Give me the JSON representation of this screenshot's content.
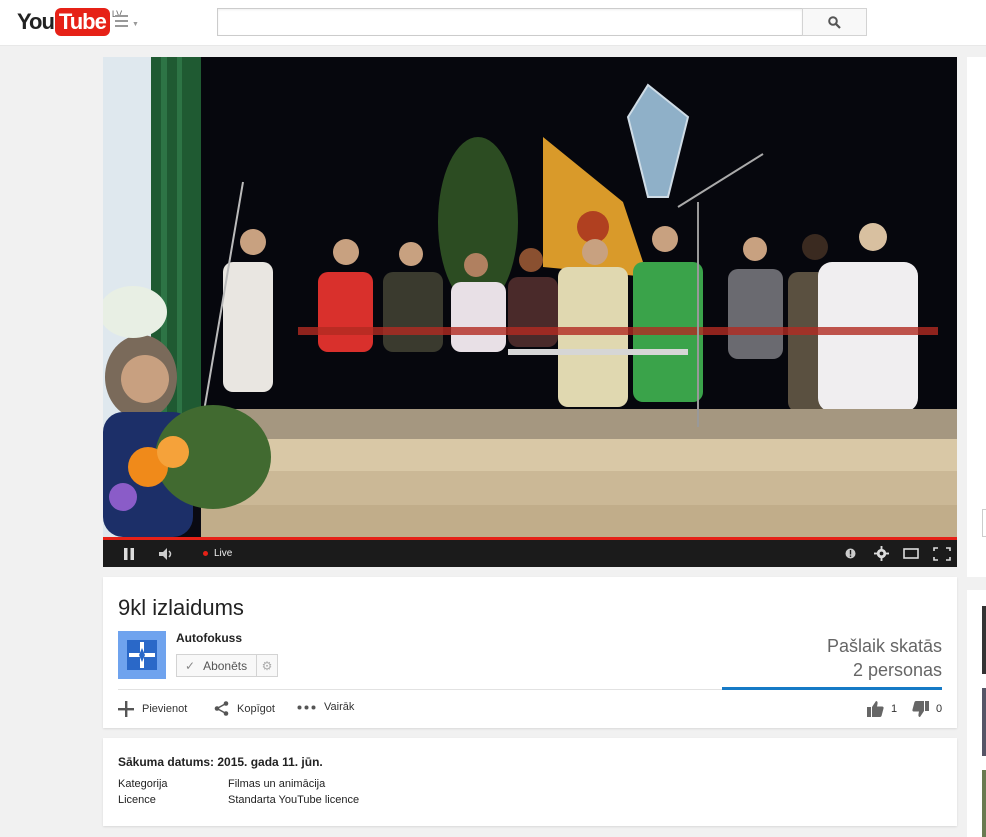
{
  "masthead": {
    "logo_you": "You",
    "logo_tube": "Tube",
    "region": "LV",
    "search_placeholder": "",
    "search_value": ""
  },
  "player": {
    "live_label": "Live",
    "progress_fraction": 1.0,
    "accent_color": "#e62117"
  },
  "video": {
    "title": "9kl izlaidums",
    "channel": "Autofokuss",
    "subscribe_label": "Abonēts",
    "viewers_line1": "Pašlaik skatās",
    "viewers_line2": "2 personas",
    "actions": {
      "add": "Pievienot",
      "share": "Kopīgot",
      "more": "Vairāk"
    },
    "likes": "1",
    "dislikes": "0"
  },
  "description": {
    "start_date": "Sākuma datums: 2015. gada 11. jūn.",
    "category_label": "Kategorija",
    "category_value": "Filmas un animācija",
    "license_label": "Licence",
    "license_value": "Standarta YouTube licence"
  },
  "colors": {
    "brand_red": "#e62117",
    "link_blue": "#167ac6",
    "avatar_blue": "#6fa3ee"
  }
}
